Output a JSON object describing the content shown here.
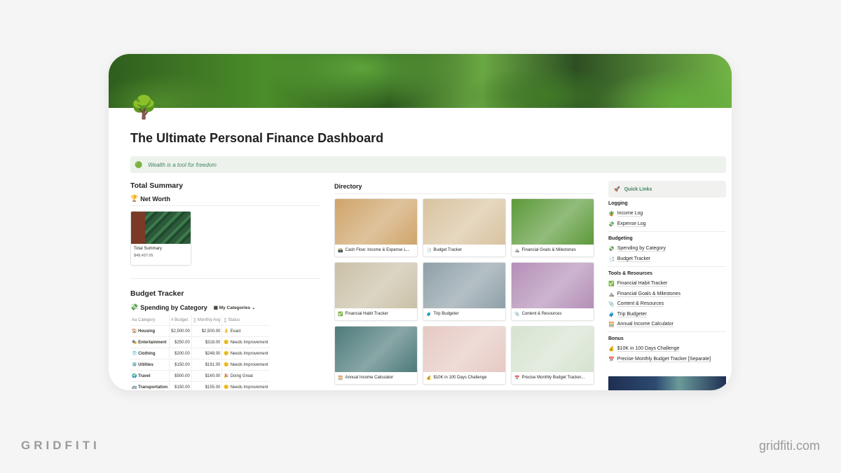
{
  "page": {
    "icon": "🌳",
    "title": "The Ultimate Personal Finance Dashboard",
    "callout": {
      "icon": "🟢",
      "text": "Wealth is a tool for freedom"
    }
  },
  "summary": {
    "heading": "Total Summary",
    "net_worth": {
      "icon": "🏆",
      "label": "Net Worth"
    },
    "card": {
      "name": "Total Summary",
      "value": "$48,437.05"
    }
  },
  "budget": {
    "heading": "Budget Tracker",
    "sub": {
      "icon": "💸",
      "label": "Spending by Category",
      "view_icon": "▦",
      "view": "My Categories",
      "chevron": "⌄"
    },
    "columns": [
      "Aa Category",
      "# Budget",
      "∑ Monthly Avg",
      "∑ Status"
    ],
    "rows": [
      {
        "icon": "🏠",
        "category": "Housing",
        "budget": "$2,500.00",
        "avg": "$2,500.00",
        "status_icon": "👌",
        "status": "Exact"
      },
      {
        "icon": "🎭",
        "category": "Entertainment",
        "budget": "$250.00",
        "avg": "$318.00",
        "status_icon": "🙁",
        "status": "Needs Improvement"
      },
      {
        "icon": "👕",
        "category": "Clothing",
        "budget": "$200.00",
        "avg": "$248.00",
        "status_icon": "🙁",
        "status": "Needs Improvement"
      },
      {
        "icon": "⚙️",
        "category": "Utilities",
        "budget": "$150.00",
        "avg": "$191.00",
        "status_icon": "🙁",
        "status": "Needs Improvement"
      },
      {
        "icon": "🌍",
        "category": "Travel",
        "budget": "$500.00",
        "avg": "$160.00",
        "status_icon": "🎉",
        "status": "Doing Great"
      },
      {
        "icon": "🚌",
        "category": "Transportation",
        "budget": "$150.00",
        "avg": "$155.00",
        "status_icon": "🙁",
        "status": "Needs Improvement"
      }
    ]
  },
  "directory": {
    "heading": "Directory",
    "cards": [
      {
        "icon": "🗃️",
        "label": "Cash Flow: Income & Expense L...",
        "bg": "#cfa46a"
      },
      {
        "icon": "📑",
        "label": "Budget Tracker",
        "bg": "#d9c3a0"
      },
      {
        "icon": "⛰️",
        "label": "Financial Goals & Milestones",
        "bg": "#5c9a3a"
      },
      {
        "icon": "✅",
        "label": "Financial Habit Tracker",
        "bg": "#c9c0a6"
      },
      {
        "icon": "🧳",
        "label": "Trip Budgeter",
        "bg": "#8fa0a8"
      },
      {
        "icon": "📎",
        "label": "Content & Resources",
        "bg": "#b48fb8"
      },
      {
        "icon": "🧮",
        "label": "Annual Income Calculator",
        "bg": "#4d7a7a"
      },
      {
        "icon": "💰",
        "label": "$10K in 100 Days Challenge",
        "bg": "#e6c9c3"
      },
      {
        "icon": "📅",
        "label": "Precise Monthly Budget Tracker...",
        "bg": "#d6e3d0"
      }
    ]
  },
  "quick_links": {
    "icon": "🚀",
    "title": "Quick Links",
    "groups": [
      {
        "name": "Logging",
        "links": [
          {
            "icon": "🪴",
            "label": "Income Log"
          },
          {
            "icon": "💸",
            "label": "Expense Log"
          }
        ]
      },
      {
        "name": "Budgeting",
        "links": [
          {
            "icon": "💸",
            "label": "Spending by Category"
          },
          {
            "icon": "📑",
            "label": "Budget Tracker"
          }
        ]
      },
      {
        "name": "Tools & Resources",
        "links": [
          {
            "icon": "✅",
            "label": "Financial Habit Tracker"
          },
          {
            "icon": "⛰️",
            "label": "Financial Goals & Milestones"
          },
          {
            "icon": "📎",
            "label": "Content & Resources"
          },
          {
            "icon": "🧳",
            "label": "Trip Budgeter"
          },
          {
            "icon": "🧮",
            "label": "Annual Income Calculator"
          }
        ]
      },
      {
        "name": "Bonus",
        "links": [
          {
            "icon": "💰",
            "label": "$10K in 100 Days Challenge"
          },
          {
            "icon": "📅",
            "label": "Precise Monthly Budget Tracker [Separate]"
          }
        ]
      }
    ]
  },
  "footer": {
    "left": "GRIDFITI",
    "right": "gridfiti.com"
  }
}
